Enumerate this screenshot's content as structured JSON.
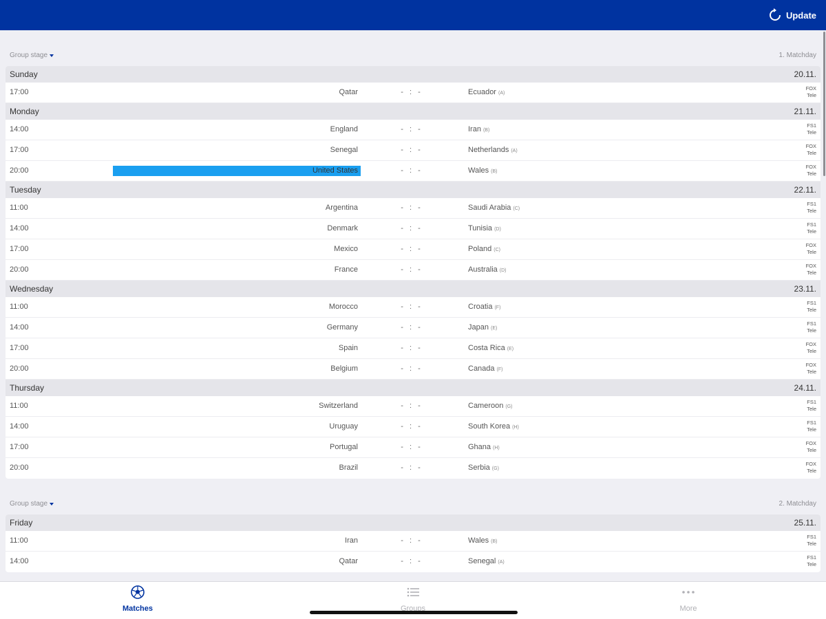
{
  "header": {
    "update_label": "Update"
  },
  "sections": [
    {
      "stage": "Group stage",
      "matchday": "1. Matchday",
      "days": [
        {
          "day": "Sunday",
          "date": "20.11.",
          "matches": [
            {
              "time": "17:00",
              "home": "Qatar",
              "score": "- : -",
              "away": "Ecuador",
              "group": "(A)",
              "tv1": "FOX",
              "tv2": "Tele"
            }
          ]
        },
        {
          "day": "Monday",
          "date": "21.11.",
          "matches": [
            {
              "time": "14:00",
              "home": "England",
              "score": "- : -",
              "away": "Iran",
              "group": "(B)",
              "tv1": "FS1",
              "tv2": "Tele"
            },
            {
              "time": "17:00",
              "home": "Senegal",
              "score": "- : -",
              "away": "Netherlands",
              "group": "(A)",
              "tv1": "FOX",
              "tv2": "Tele"
            },
            {
              "time": "20:00",
              "home": "United States",
              "score": "- : -",
              "away": "Wales",
              "group": "(B)",
              "tv1": "FOX",
              "tv2": "Tele",
              "highlighted": true
            }
          ]
        },
        {
          "day": "Tuesday",
          "date": "22.11.",
          "matches": [
            {
              "time": "11:00",
              "home": "Argentina",
              "score": "- : -",
              "away": "Saudi Arabia",
              "group": "(C)",
              "tv1": "FS1",
              "tv2": "Tele"
            },
            {
              "time": "14:00",
              "home": "Denmark",
              "score": "- : -",
              "away": "Tunisia",
              "group": "(D)",
              "tv1": "FS1",
              "tv2": "Tele"
            },
            {
              "time": "17:00",
              "home": "Mexico",
              "score": "- : -",
              "away": "Poland",
              "group": "(C)",
              "tv1": "FOX",
              "tv2": "Tele"
            },
            {
              "time": "20:00",
              "home": "France",
              "score": "- : -",
              "away": "Australia",
              "group": "(D)",
              "tv1": "FOX",
              "tv2": "Tele"
            }
          ]
        },
        {
          "day": "Wednesday",
          "date": "23.11.",
          "matches": [
            {
              "time": "11:00",
              "home": "Morocco",
              "score": "- : -",
              "away": "Croatia",
              "group": "(F)",
              "tv1": "FS1",
              "tv2": "Tele"
            },
            {
              "time": "14:00",
              "home": "Germany",
              "score": "- : -",
              "away": "Japan",
              "group": "(E)",
              "tv1": "FS1",
              "tv2": "Tele"
            },
            {
              "time": "17:00",
              "home": "Spain",
              "score": "- : -",
              "away": "Costa Rica",
              "group": "(E)",
              "tv1": "FOX",
              "tv2": "Tele"
            },
            {
              "time": "20:00",
              "home": "Belgium",
              "score": "- : -",
              "away": "Canada",
              "group": "(F)",
              "tv1": "FOX",
              "tv2": "Tele"
            }
          ]
        },
        {
          "day": "Thursday",
          "date": "24.11.",
          "matches": [
            {
              "time": "11:00",
              "home": "Switzerland",
              "score": "- : -",
              "away": "Cameroon",
              "group": "(G)",
              "tv1": "FS1",
              "tv2": "Tele"
            },
            {
              "time": "14:00",
              "home": "Uruguay",
              "score": "- : -",
              "away": "South Korea",
              "group": "(H)",
              "tv1": "FS1",
              "tv2": "Tele"
            },
            {
              "time": "17:00",
              "home": "Portugal",
              "score": "- : -",
              "away": "Ghana",
              "group": "(H)",
              "tv1": "FOX",
              "tv2": "Tele"
            },
            {
              "time": "20:00",
              "home": "Brazil",
              "score": "- : -",
              "away": "Serbia",
              "group": "(G)",
              "tv1": "FOX",
              "tv2": "Tele"
            }
          ]
        }
      ]
    },
    {
      "stage": "Group stage",
      "matchday": "2. Matchday",
      "days": [
        {
          "day": "Friday",
          "date": "25.11.",
          "matches": [
            {
              "time": "11:00",
              "home": "Iran",
              "score": "- : -",
              "away": "Wales",
              "group": "(B)",
              "tv1": "FS1",
              "tv2": "Tele"
            },
            {
              "time": "14:00",
              "home": "Qatar",
              "score": "- : -",
              "away": "Senegal",
              "group": "(A)",
              "tv1": "FS1",
              "tv2": "Tele"
            }
          ]
        }
      ]
    }
  ],
  "tabs": [
    {
      "label": "Matches",
      "icon": "soccer-ball-icon",
      "active": true
    },
    {
      "label": "Groups",
      "icon": "list-icon",
      "active": false
    },
    {
      "label": "More",
      "icon": "more-dots-icon",
      "active": false
    }
  ],
  "colors": {
    "header": "#0033a0",
    "highlight": "#1a9ff0",
    "day_row": "#e5e5ea",
    "background": "#efeff4"
  }
}
